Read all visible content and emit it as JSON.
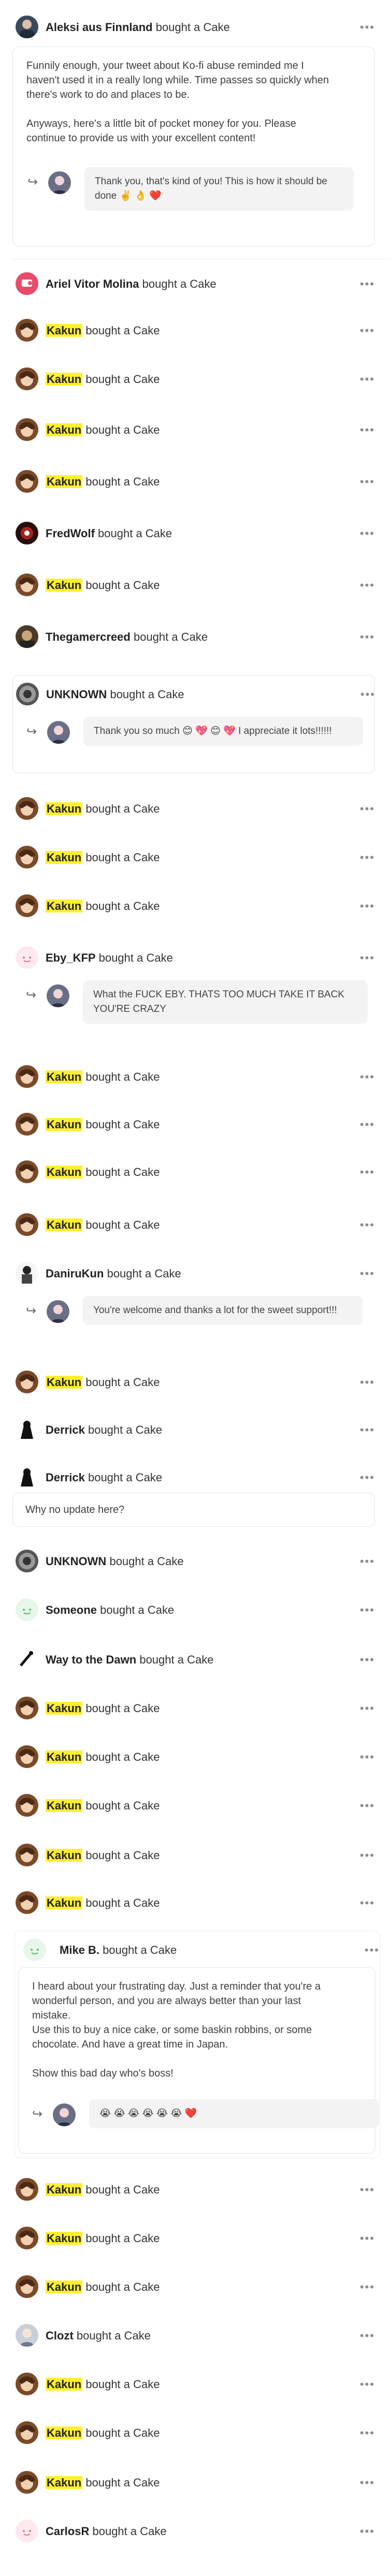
{
  "card_top": {
    "supporter": "Aleksi aus Finnland",
    "action": "bought a Cake",
    "message_lines": [
      "Funnily enough, your tweet about Ko-fi abuse reminded me I",
      "haven't used it in a really long while. Time passes so quickly when",
      "there's work to do and places to be.",
      "",
      "Anyways, here's a little bit of pocket money for you. Please",
      "continue to provide us with your excellent content!"
    ],
    "reply": "Thank you, that's kind of you! This is how it should be done ✌️ 👌 ❤️"
  },
  "supporters": [
    {
      "name": "Ariel Vitor Molina",
      "action": "bought a Cake",
      "highlight": false
    },
    {
      "name": "Kakun",
      "action": "bought a Cake",
      "highlight": true
    },
    {
      "name": "Kakun",
      "action": "bought a Cake",
      "highlight": true
    },
    {
      "name": "Kakun",
      "action": "bought a Cake",
      "highlight": true
    },
    {
      "name": "Kakun",
      "action": "bought a Cake",
      "highlight": true
    },
    {
      "name": "FredWolf",
      "action": "bought a Cake",
      "highlight": false
    },
    {
      "name": "Kakun",
      "action": "bought a Cake",
      "highlight": true
    },
    {
      "name": "Thegamercreed",
      "action": "bought a Cake",
      "highlight": false
    },
    {
      "name": "UNKNOWN",
      "action": "bought a Cake",
      "highlight": false
    },
    {
      "name": "Kakun",
      "action": "bought a Cake",
      "highlight": true
    },
    {
      "name": "Kakun",
      "action": "bought a Cake",
      "highlight": true
    },
    {
      "name": "Kakun",
      "action": "bought a Cake",
      "highlight": true
    },
    {
      "name": "Eby_KFP",
      "action": "bought a Cake",
      "highlight": false
    },
    {
      "name": "Kakun",
      "action": "bought a Cake",
      "highlight": true
    },
    {
      "name": "Kakun",
      "action": "bought a Cake",
      "highlight": true
    },
    {
      "name": "Kakun",
      "action": "bought a Cake",
      "highlight": true
    },
    {
      "name": "Kakun",
      "action": "bought a Cake",
      "highlight": true
    },
    {
      "name": "DaniruKun",
      "action": "bought a Cake",
      "highlight": false
    },
    {
      "name": "Kakun",
      "action": "bought a Cake",
      "highlight": true
    },
    {
      "name": "Derrick",
      "action": "bought a Cake",
      "highlight": false
    },
    {
      "name": "Derrick",
      "action": "bought a Cake",
      "highlight": false
    },
    {
      "name": "UNKNOWN",
      "action": "bought a Cake",
      "highlight": false
    },
    {
      "name": "Someone",
      "action": "bought a Cake",
      "highlight": false
    },
    {
      "name": "Way to the Dawn",
      "action": "bought a Cake",
      "highlight": false
    },
    {
      "name": "Kakun",
      "action": "bought a Cake",
      "highlight": true
    },
    {
      "name": "Kakun",
      "action": "bought a Cake",
      "highlight": true
    },
    {
      "name": "Kakun",
      "action": "bought a Cake",
      "highlight": true
    },
    {
      "name": "Kakun",
      "action": "bought a Cake",
      "highlight": true
    },
    {
      "name": "Kakun",
      "action": "bought a Cake",
      "highlight": true
    },
    {
      "name": "Mike B.",
      "action": "bought a Cake",
      "highlight": false
    },
    {
      "name": "Kakun",
      "action": "bought a Cake",
      "highlight": true
    },
    {
      "name": "Kakun",
      "action": "bought a Cake",
      "highlight": true
    },
    {
      "name": "Kakun",
      "action": "bought a Cake",
      "highlight": true
    },
    {
      "name": "Clozt",
      "action": "bought a Cake",
      "highlight": false
    },
    {
      "name": "Kakun",
      "action": "bought a Cake",
      "highlight": true
    },
    {
      "name": "Kakun",
      "action": "bought a Cake",
      "highlight": true
    },
    {
      "name": "Kakun",
      "action": "bought a Cake",
      "highlight": true
    },
    {
      "name": "CarlosR",
      "action": "bought a Cake",
      "highlight": false
    }
  ],
  "replies": {
    "unknown": "Thank you so much 😊 💖 😊 💖 I appreciate it lots!!!!!!",
    "eby": "What the FUCK EBY. THATS TOO MUCH TAKE IT BACK YOU'RE CRAZY",
    "daniru": "You're welcome and thanks a lot for the sweet support!!!",
    "derrick_note": "Why no update here?"
  },
  "mike_card": {
    "message_lines": [
      "I heard about your frustrating day. Just a reminder that you're a",
      "wonderful person, and you are always better than your last",
      "mistake.",
      "Use this to buy a nice cake, or some baskin robbins, or some",
      "chocolate. And have a great time in Japan.",
      "",
      "Show this bad day who's boss!"
    ],
    "reply": "😭 😭 😭 😭 😭 😭 ❤️"
  },
  "more_icon": "more-dots-icon",
  "reply_icon": "reply-arrow-icon",
  "colors": {
    "highlight": "#ffef2f",
    "border": "#e6e6e6",
    "bubble": "#f3f3f3"
  }
}
